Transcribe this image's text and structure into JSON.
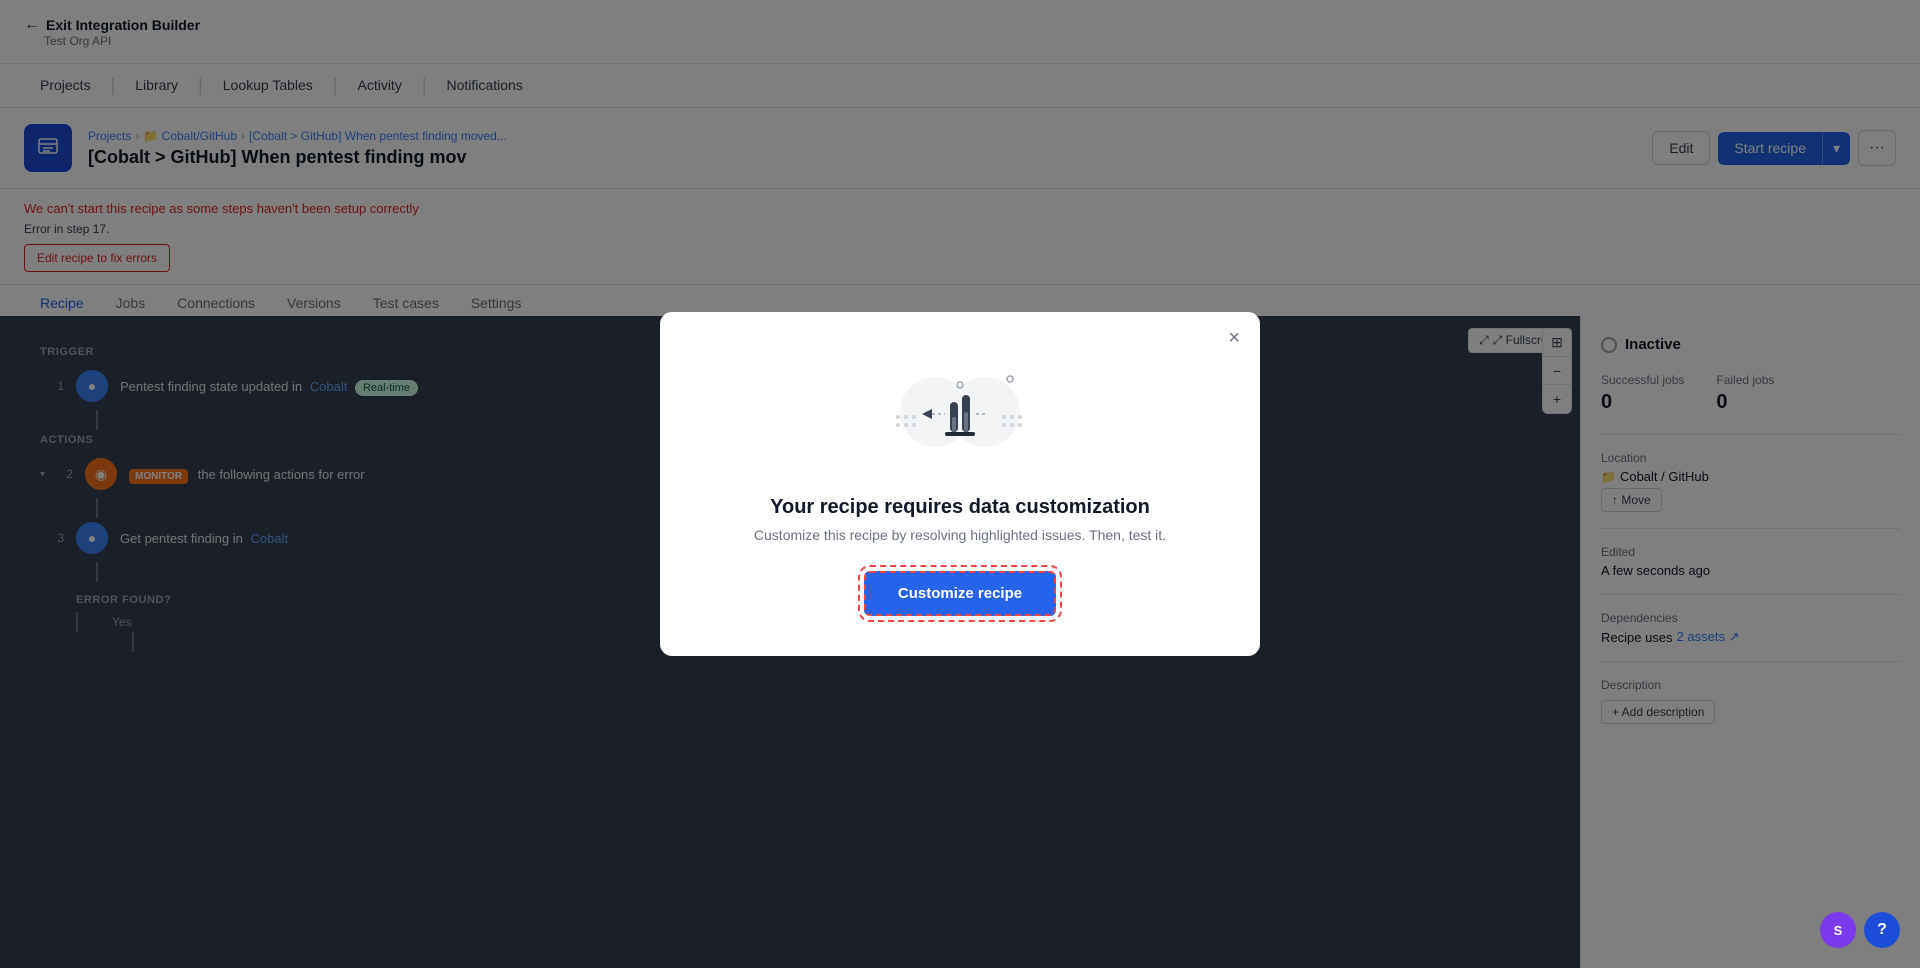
{
  "topbar": {
    "back_label": "Exit Integration Builder",
    "subtitle": "Test Org API",
    "back_arrow": "←"
  },
  "nav": {
    "items": [
      "Projects",
      "Library",
      "Lookup Tables",
      "Activity",
      "Notifications"
    ]
  },
  "breadcrumb": {
    "parts": [
      "Projects",
      "Cobalt/GitHub",
      "[Cobalt > GitHub] When pentest finding moved..."
    ]
  },
  "recipe": {
    "title": "[Cobalt > GitHub] When pentest finding mov",
    "edit_label": "Edit",
    "start_label": "Start recipe",
    "more_label": "···"
  },
  "error_banner": {
    "message": "We can't start this recipe as some steps haven't been setup correctly",
    "step": "Error in step 17.",
    "fix_label": "Edit recipe to fix errors"
  },
  "tabs": [
    "Recipe",
    "Jobs",
    "Connections",
    "Versions",
    "Test cases",
    "Settings"
  ],
  "canvas": {
    "fullscreen_label": "⤢ Fullscreen",
    "trigger_label": "TRIGGER",
    "actions_label": "ACTIONS",
    "error_found_label": "ERROR FOUND?",
    "yes_label": "Yes",
    "steps": [
      {
        "num": "1",
        "type": "blue",
        "icon": "●",
        "text": "Pentest finding state updated in",
        "link": "Cobalt",
        "badge": "Real-time",
        "badge_type": "blue"
      },
      {
        "num": "2",
        "type": "orange",
        "icon": "◉",
        "prefix": "MONITOR",
        "text": "the following actions for error"
      },
      {
        "num": "3",
        "type": "blue",
        "icon": "●",
        "text": "Get pentest finding in",
        "link": "Cobalt"
      }
    ]
  },
  "right_panel": {
    "status_label": "Inactive",
    "successful_jobs_label": "Successful jobs",
    "successful_jobs_value": "0",
    "failed_jobs_label": "Failed jobs",
    "failed_jobs_value": "0",
    "location_label": "Location",
    "location_value": "Cobalt / GitHub",
    "move_label": "↑ Move",
    "edited_label": "Edited",
    "edited_value": "A few seconds ago",
    "dependencies_label": "Dependencies",
    "dependencies_value": "Recipe uses",
    "dependencies_link": "2 assets ↗",
    "description_label": "Description",
    "add_description_label": "+ Add description"
  },
  "modal": {
    "title": "Your recipe requires data customization",
    "subtitle": "Customize this recipe by resolving highlighted issues. Then, test it.",
    "customize_label": "Customize recipe",
    "close_label": "×"
  },
  "avatar": {
    "initials": "S",
    "help_label": "?"
  },
  "zoom_controls": {
    "fit": "⊞",
    "minus": "−",
    "plus": "+"
  }
}
